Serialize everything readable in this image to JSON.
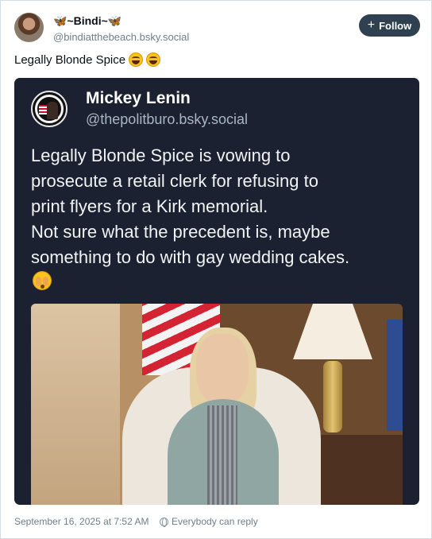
{
  "author": {
    "display_name": "🦋~Bindi~🦋",
    "handle": "@bindiatthebeach.bsky.social",
    "follow_label": "Follow",
    "follow_icon": "+"
  },
  "post": {
    "text": "Legally Blonde Spice",
    "emojis": [
      "laughing-face",
      "laughing-face"
    ]
  },
  "quoted": {
    "display_name": "Mickey Lenin",
    "handle": "@thepolitburo.bsky.social",
    "lines": [
      "Legally Blonde Spice is vowing to",
      "prosecute a retail clerk for refusing to",
      "print flyers for a Kirk memorial.",
      "Not sure what the precedent is, maybe",
      "something to do with gay wedding cakes."
    ],
    "trailing_emoji": "face-with-hand-over-eyes"
  },
  "footer": {
    "timestamp": "September 16, 2025 at 7:52 AM",
    "reply_setting": "Everybody can reply",
    "reply_icon": "globe-icon"
  },
  "colors": {
    "accent": "#2f4050",
    "embed_bg": "#1b2131",
    "muted": "#6f7e8c"
  }
}
